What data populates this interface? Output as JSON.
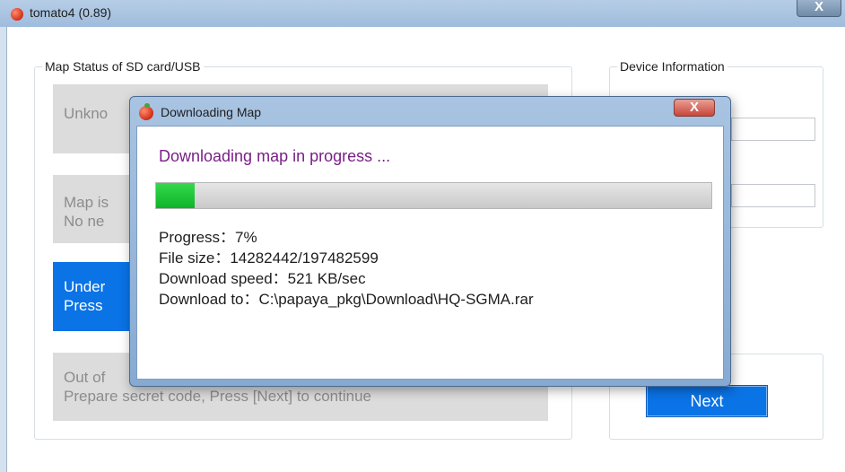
{
  "window": {
    "title": "tomato4 (0.89)",
    "close_glyph": "X",
    "icon": "tomato-icon"
  },
  "map_status": {
    "group_title": "Map Status of SD card/USB",
    "boxes": [
      {
        "line1": "Unkno",
        "line2": ""
      },
      {
        "line1": "Map is",
        "line2": "No ne"
      },
      {
        "line1": "Under",
        "line2": "Press"
      },
      {
        "line1": "Out of",
        "line2": "Prepare secret code, Press [Next] to continue"
      }
    ]
  },
  "device_info": {
    "group_title": "Device Information"
  },
  "next_button": {
    "label": "Next"
  },
  "dialog": {
    "title": "Downloading Map",
    "close_glyph": "X",
    "icon": "tomato-icon",
    "heading": "Downloading map in progress ...",
    "progress_fraction": 0.07,
    "lines": {
      "progress": "Progress：7%",
      "file_size": "File size：14282442/197482599",
      "speed": "Download speed：521 KB/sec",
      "download_to": "Download to：C:\\papaya_pkg\\Download\\HQ-SGMA.rar"
    }
  },
  "colors": {
    "accent": "#0a73e6",
    "heading": "#7a1f88",
    "progress": "#1ec53a"
  }
}
